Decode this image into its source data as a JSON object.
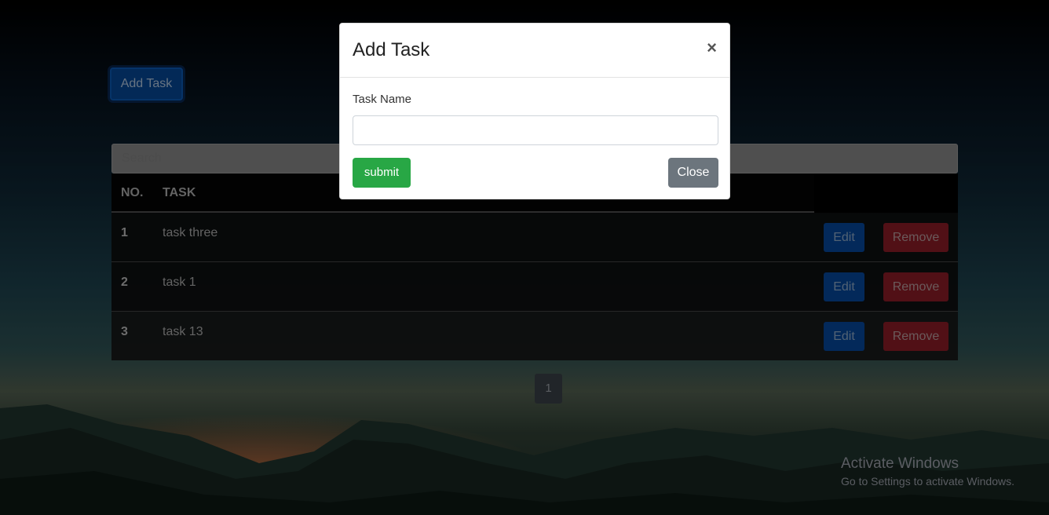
{
  "toolbar": {
    "add_task_label": "Add Task"
  },
  "search": {
    "placeholder": "Search"
  },
  "table": {
    "headers": {
      "no": "NO.",
      "task": "TASK"
    },
    "rows": [
      {
        "no": "1",
        "task": "task three"
      },
      {
        "no": "2",
        "task": "task 1"
      },
      {
        "no": "3",
        "task": "task 13"
      }
    ],
    "edit_label": "Edit",
    "remove_label": "Remove"
  },
  "pagination": {
    "current_page": "1"
  },
  "modal": {
    "title": "Add Task",
    "close_symbol": "×",
    "field_label": "Task Name",
    "field_value": "",
    "submit_label": "submit",
    "close_label": "Close"
  },
  "watermark": {
    "title": "Activate Windows",
    "subtitle": "Go to Settings to activate Windows."
  },
  "colors": {
    "primary": "#007bff",
    "danger": "#dc3545",
    "success": "#28a745",
    "secondary": "#6c757d"
  }
}
